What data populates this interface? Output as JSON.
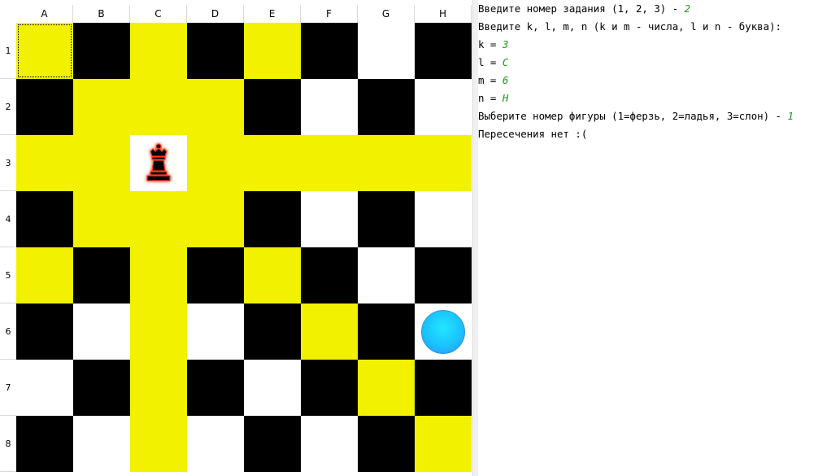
{
  "board": {
    "columns": [
      "A",
      "B",
      "C",
      "D",
      "E",
      "F",
      "G",
      "H"
    ],
    "rows": [
      "1",
      "2",
      "3",
      "4",
      "5",
      "6",
      "7",
      "8"
    ],
    "colors": {
      "Y": "#f1f100",
      "B": "#000000",
      "W": "#ffffff"
    },
    "cells": [
      [
        "Y",
        "B",
        "Y",
        "B",
        "Y",
        "B",
        "W",
        "B"
      ],
      [
        "B",
        "Y",
        "Y",
        "Y",
        "B",
        "W",
        "B",
        "W"
      ],
      [
        "Y",
        "Y",
        "W",
        "Y",
        "Y",
        "Y",
        "Y",
        "Y"
      ],
      [
        "B",
        "Y",
        "Y",
        "Y",
        "B",
        "W",
        "B",
        "W"
      ],
      [
        "Y",
        "B",
        "Y",
        "B",
        "Y",
        "B",
        "W",
        "B"
      ],
      [
        "B",
        "W",
        "Y",
        "W",
        "B",
        "Y",
        "B",
        "W"
      ],
      [
        "W",
        "B",
        "Y",
        "B",
        "W",
        "B",
        "Y",
        "B"
      ],
      [
        "B",
        "W",
        "Y",
        "W",
        "B",
        "W",
        "B",
        "Y"
      ]
    ],
    "selected_cell": "A1",
    "piece": {
      "type": "queen",
      "icon": "chess-queen-icon",
      "cell": "C3"
    },
    "target": {
      "icon": "blue-circle-marker-icon",
      "cell": "H6"
    }
  },
  "console": {
    "lines": [
      {
        "text": "Введите номер задания (1, 2, 3) - ",
        "input": "2"
      },
      {
        "text": "Введите k, l, m, n (k и m - числа, l и n - буква):",
        "input": ""
      },
      {
        "text": "k = ",
        "input": "3"
      },
      {
        "text": "l = ",
        "input": "C"
      },
      {
        "text": "m = ",
        "input": "6"
      },
      {
        "text": "n = ",
        "input": "H"
      },
      {
        "text": "Выберите номер фигуры (1=ферзь, 2=ладья, 3=слон) - ",
        "input": "1"
      },
      {
        "text": "Пересечения нет :(",
        "input": ""
      }
    ]
  }
}
